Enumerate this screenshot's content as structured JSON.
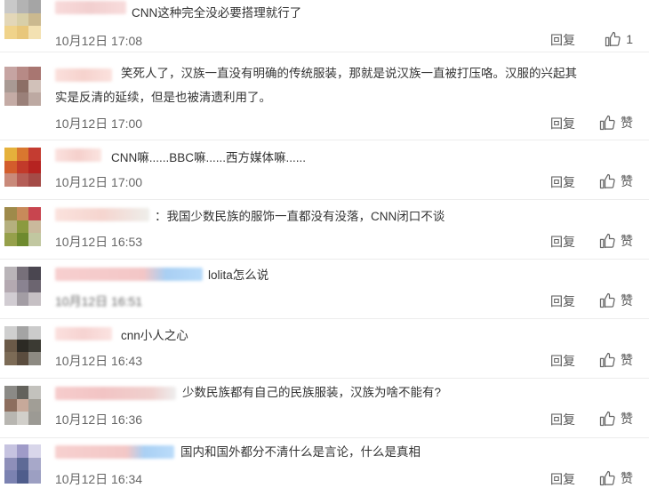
{
  "comments": [
    {
      "text": "CNN这种完全没必要搭理就行了",
      "time": "10月12日 17:08",
      "reply": "回复",
      "like": "1",
      "avatar": [
        "#c9c9c9",
        "#b3b3b3",
        "#a5a5a5",
        "#e3d7b8",
        "#d8cfa8",
        "#cbb98f",
        "#f0d38a",
        "#e8c77b",
        "#f3e1b2"
      ],
      "name_color": "#f6cfcf"
    },
    {
      "text": "笑死人了，汉族一直没有明确的传统服装，那就是说汉族一直被打压咯。汉服的兴起其",
      "text2": "实是反清的延续，但是也被清遗利用了。",
      "time": "10月12日 17:00",
      "reply": "回复",
      "like": "赞",
      "avatar": [
        "#c6a4a2",
        "#b78a86",
        "#a87671",
        "#a99a94",
        "#8c6f66",
        "#d1c1b9",
        "#c4aba5",
        "#9a8079",
        "#bda9a2"
      ],
      "name_color": "#f8d6d2"
    },
    {
      "text": "CNN嘛......BBC嘛......西方媒体嘛......",
      "time": "10月12日 17:00",
      "reply": "回复",
      "like": "赞",
      "avatar": [
        "#e5b13b",
        "#d9772f",
        "#c43c31",
        "#d35d2c",
        "#c23a2a",
        "#b62321",
        "#c98a7a",
        "#b45e57",
        "#a44b47"
      ],
      "name_color": "#f7d3cf"
    },
    {
      "text": "：我国少数民族的服饰一直都没有没落，CNN闭口不谈",
      "time": "10月12日 16:53",
      "reply": "回复",
      "like": "赞",
      "avatar": [
        "#9e8a4a",
        "#c88a5a",
        "#c8454f",
        "#b5b07e",
        "#8b9a3f",
        "#cab99c",
        "#96a04b",
        "#6e8a2e",
        "#c1c7a0"
      ],
      "name_color": "#f7d9d4"
    },
    {
      "text": "lolita怎么说",
      "time": "10月12日 16:51",
      "reply": "回复",
      "like": "赞",
      "avatar": [
        "#b9b4b8",
        "#77707a",
        "#4a4650",
        "#b4a9b1",
        "#8a8391",
        "#6c6570",
        "#d1ccd2",
        "#a39da4",
        "#c6c0c4"
      ],
      "name_color": "#f6cccc"
    },
    {
      "text": "cnn小人之心",
      "time": "10月12日 16:43",
      "reply": "回复",
      "like": "赞",
      "avatar": [
        "#cfcfcf",
        "#a4a4a4",
        "#cbcbcb",
        "#6b5a48",
        "#2c2a24",
        "#3b3a33",
        "#7c6b56",
        "#5a4c3e",
        "#8d8a82"
      ],
      "name_color": "#f8d8d6"
    },
    {
      "text": "少数民族都有自己的民族服装，汉族为啥不能有?",
      "time": "10月12日 16:36",
      "reply": "回复",
      "like": "赞",
      "avatar": [
        "#8b8a86",
        "#63625c",
        "#c3c2bd",
        "#8d6e5e",
        "#c7a99a",
        "#a19e96",
        "#b8b6b1",
        "#d1cfca",
        "#9c9a94"
      ],
      "name_color": "#f5c9c9"
    },
    {
      "text": "国内和国外都分不清什么是言论，什么是真相",
      "time": "10月12日 16:34",
      "reply": "回复",
      "like": "赞",
      "avatar": [
        "#c6c3e0",
        "#9f9bc8",
        "#d8d6ea",
        "#8e8fb9",
        "#5e6a96",
        "#a7a8c9",
        "#7b82b1",
        "#4f5d8c",
        "#9c9fc2"
      ],
      "name_color": "#f6cdcc"
    }
  ]
}
